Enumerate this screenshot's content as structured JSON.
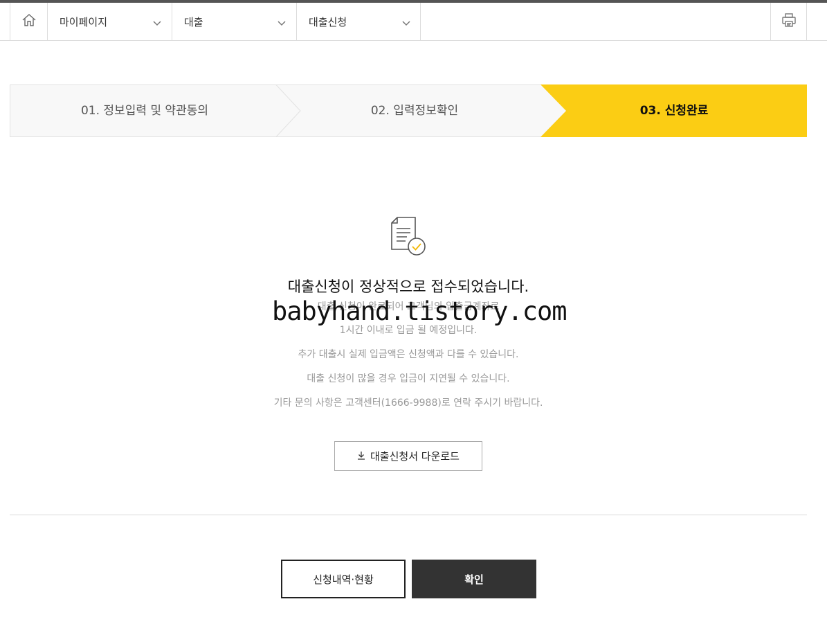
{
  "nav": {
    "home_icon": "home-icon",
    "crumbs": [
      {
        "label": "마이페이지"
      },
      {
        "label": "대출"
      },
      {
        "label": "대출신청"
      }
    ],
    "print_icon": "printer-icon"
  },
  "steps": [
    {
      "label": "01. 정보입력 및 약관동의"
    },
    {
      "label": "02. 입력정보확인"
    },
    {
      "label": "03. 신청완료"
    }
  ],
  "accent_color": "#fbcd14",
  "complete": {
    "icon": "document-check-icon",
    "title": "대출신청이 정상적으로 접수되었습니다.",
    "lines": [
      "대출 신청이 완료되어 고객님의 입출금계좌로",
      "1시간 이내로 입금 될 예정입니다.",
      "추가 대출시 실제 입금액은 신청액과 다를 수 있습니다.",
      "대출 신청이 많을 경우 입금이 지연될 수 있습니다.",
      "기타 문의 사항은 고객센터(1666-9988)로 연락 주시기 바랍니다."
    ],
    "watermark": "babyhand.tistory.com",
    "download_label": "대출신청서 다운로드"
  },
  "buttons": {
    "history_label": "신청내역·현황",
    "confirm_label": "확인"
  }
}
